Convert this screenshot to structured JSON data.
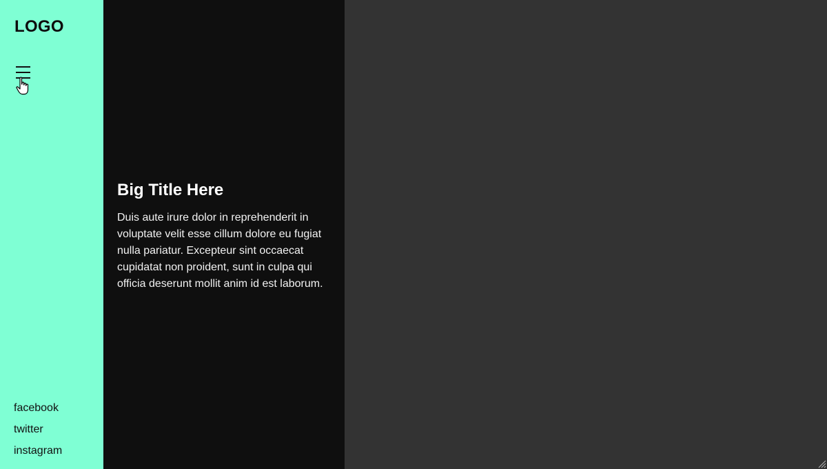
{
  "colors": {
    "sidebar_bg": "#7fffd4",
    "text_panel_bg": "#0f0f0f",
    "image_panel_bg": "#333333"
  },
  "sidebar": {
    "logo": "LOGO",
    "menu_icon": "hamburger-menu-icon",
    "social_links": [
      "facebook",
      "twitter",
      "instagram"
    ]
  },
  "content": {
    "title": "Big Title Here",
    "body": "Duis aute irure dolor in reprehenderit in voluptate velit esse cillum dolore eu fugiat nulla pariatur. Excepteur sint occaecat cupidatat non proident, sunt in culpa qui officia deserunt mollit anim id est laborum."
  }
}
